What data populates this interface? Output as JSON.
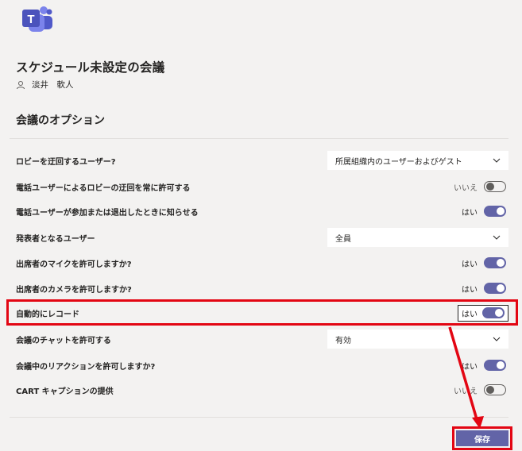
{
  "app": {
    "logo_icon": "teams-logo-icon",
    "brand_color": "#6264a7"
  },
  "meeting": {
    "title": "スケジュール未設定の会議",
    "organizer": "淡井　軟人"
  },
  "section_title": "会議のオプション",
  "options": {
    "bypass_lobby": {
      "label": "ロビーを迂回するユーザー?",
      "value": "所属組織内のユーザーおよびゲスト"
    },
    "phone_bypass": {
      "label": "電話ユーザーによるロビーの迂回を常に許可する",
      "state": "いいえ",
      "on": false
    },
    "announce": {
      "label": "電話ユーザーが参加または退出したときに知らせる",
      "state": "はい",
      "on": true
    },
    "presenters": {
      "label": "発表者となるユーザー",
      "value": "全員"
    },
    "mic": {
      "label": "出席者のマイクを許可しますか?",
      "state": "はい",
      "on": true
    },
    "camera": {
      "label": "出席者のカメラを許可しますか?",
      "state": "はい",
      "on": true
    },
    "auto_record": {
      "label": "自動的にレコード",
      "state": "はい",
      "on": true
    },
    "chat": {
      "label": "会議のチャットを許可する",
      "value": "有効"
    },
    "reactions": {
      "label": "会議中のリアクションを許可しますか?",
      "state": "はい",
      "on": true
    },
    "cart": {
      "label": "CART キャプションの提供",
      "state": "いいえ",
      "on": false
    }
  },
  "save_label": "保存",
  "annotation_color": "#e30613"
}
